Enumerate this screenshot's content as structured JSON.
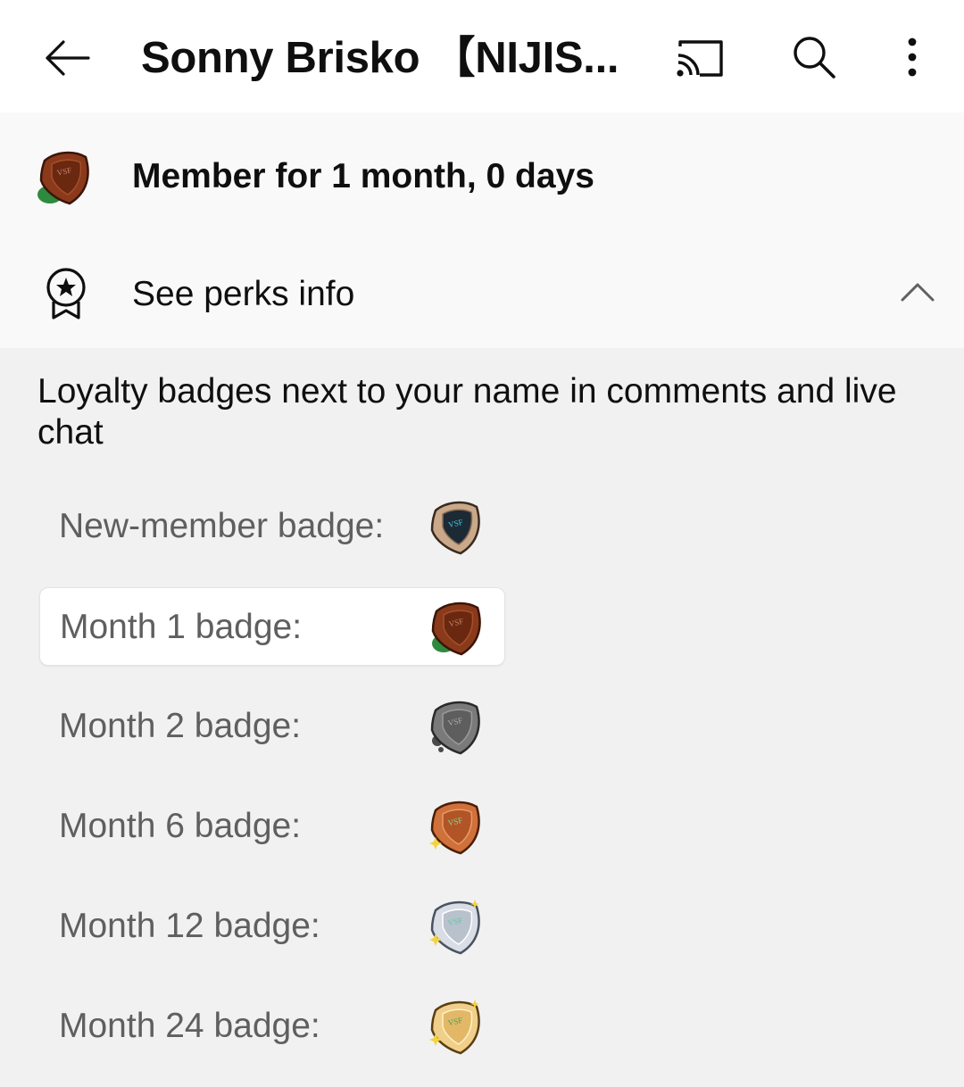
{
  "header": {
    "title": "Sonny Brisko 【NIJIS...",
    "back_icon": "arrow-left-icon",
    "cast_icon": "cast-icon",
    "search_icon": "search-icon",
    "more_icon": "more-vert-icon"
  },
  "membership": {
    "status": "Member for 1 month, 0 days",
    "badge_icon": "month-1-badge-icon"
  },
  "perks": {
    "label": "See perks info",
    "icon": "award-ribbon-icon",
    "expanded": true,
    "description": "Loyalty badges next to your name in comments and live chat"
  },
  "badges": [
    {
      "label": "New-member badge:",
      "icon": "new-member-badge-icon",
      "colors": [
        "#c9a98a",
        "#8b6a52"
      ],
      "selected": false
    },
    {
      "label": "Month 1 badge:",
      "icon": "month-1-badge-icon",
      "colors": [
        "#8a3a1a",
        "#5a230d"
      ],
      "selected": true
    },
    {
      "label": "Month 2 badge:",
      "icon": "month-2-badge-icon",
      "colors": [
        "#7a7a7a",
        "#4a4a4a"
      ],
      "selected": false
    },
    {
      "label": "Month 6 badge:",
      "icon": "month-6-badge-icon",
      "colors": [
        "#d0703a",
        "#9a4218"
      ],
      "selected": false
    },
    {
      "label": "Month 12 badge:",
      "icon": "month-12-badge-icon",
      "colors": [
        "#d8dde6",
        "#9aa3b0"
      ],
      "selected": false
    },
    {
      "label": "Month 24 badge:",
      "icon": "month-24-badge-icon",
      "colors": [
        "#f0cf8a",
        "#c4954a"
      ],
      "selected": false
    }
  ]
}
